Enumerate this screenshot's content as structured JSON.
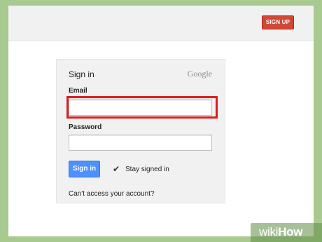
{
  "header": {
    "signup_label": "SIGN UP"
  },
  "signin_card": {
    "title": "Sign in",
    "brand": "Google",
    "email_label": "Email",
    "email_value": "",
    "password_label": "Password",
    "password_value": "",
    "signin_button": "Sign in",
    "stay_signed_in_label": "Stay signed in",
    "stay_signed_in_checked": true,
    "help_link": "Can't access your account?"
  },
  "colors": {
    "signup_red": "#d14836",
    "signin_blue": "#4d90fe",
    "highlight_red": "#d81e1e",
    "frame_green": "#a8c98f"
  },
  "watermark": {
    "prefix": "wiki",
    "suffix": "How"
  }
}
